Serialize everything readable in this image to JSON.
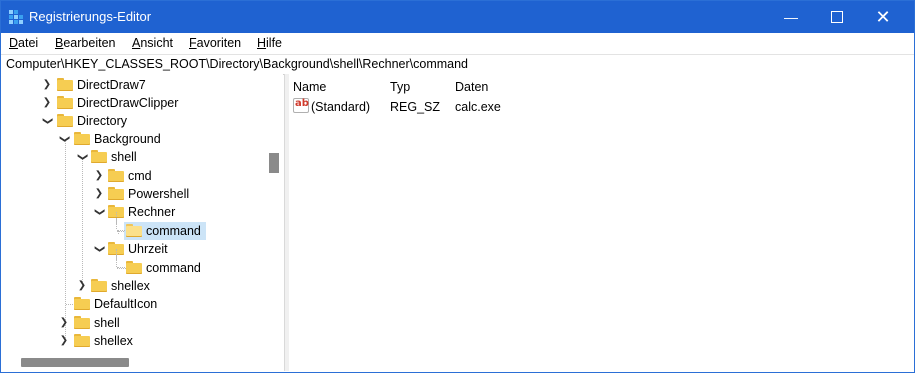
{
  "window": {
    "title": "Registrierungs-Editor",
    "controls": {
      "minimize": "—",
      "close": "✕"
    },
    "accent_color": "#1f62d1"
  },
  "menu": [
    {
      "label": "Datei",
      "mnemonic": "D",
      "rest": "atei"
    },
    {
      "label": "Bearbeiten",
      "mnemonic": "B",
      "rest": "earbeiten"
    },
    {
      "label": "Ansicht",
      "mnemonic": "A",
      "rest": "nsicht"
    },
    {
      "label": "Favoriten",
      "mnemonic": "F",
      "rest": "avoriten"
    },
    {
      "label": "Hilfe",
      "mnemonic": "H",
      "rest": "ilfe"
    }
  ],
  "address": "Computer\\HKEY_CLASSES_ROOT\\Directory\\Background\\shell\\Rechner\\command",
  "tree": [
    {
      "label": "DirectDraw7",
      "state": "collapsed",
      "icon": "folder-icon"
    },
    {
      "label": "DirectDrawClipper",
      "state": "collapsed",
      "icon": "folder-icon"
    },
    {
      "label": "Directory",
      "state": "expanded",
      "icon": "folder-icon"
    },
    {
      "label": "Background",
      "state": "expanded",
      "icon": "folder-icon"
    },
    {
      "label": "shell",
      "state": "expanded",
      "icon": "folder-icon"
    },
    {
      "label": "cmd",
      "state": "collapsed",
      "icon": "folder-icon"
    },
    {
      "label": "Powershell",
      "state": "collapsed",
      "icon": "folder-icon"
    },
    {
      "label": "Rechner",
      "state": "expanded",
      "icon": "folder-icon"
    },
    {
      "label": "command",
      "state": "leaf",
      "selected": true,
      "icon": "folder-open-icon"
    },
    {
      "label": "Uhrzeit",
      "state": "expanded",
      "icon": "folder-icon"
    },
    {
      "label": "command",
      "state": "leaf",
      "icon": "folder-icon"
    },
    {
      "label": "shellex",
      "state": "collapsed",
      "icon": "folder-icon"
    },
    {
      "label": "DefaultIcon",
      "state": "leaf",
      "icon": "folder-icon"
    },
    {
      "label": "shell",
      "state": "collapsed",
      "icon": "folder-icon"
    },
    {
      "label": "shellex",
      "state": "collapsed",
      "icon": "folder-icon"
    }
  ],
  "list": {
    "columns": [
      "Name",
      "Typ",
      "Daten"
    ],
    "rows": [
      {
        "icon": "string-value-icon",
        "icon_text": "ab",
        "name": "(Standard)",
        "type": "REG_SZ",
        "data": "calc.exe"
      }
    ]
  }
}
